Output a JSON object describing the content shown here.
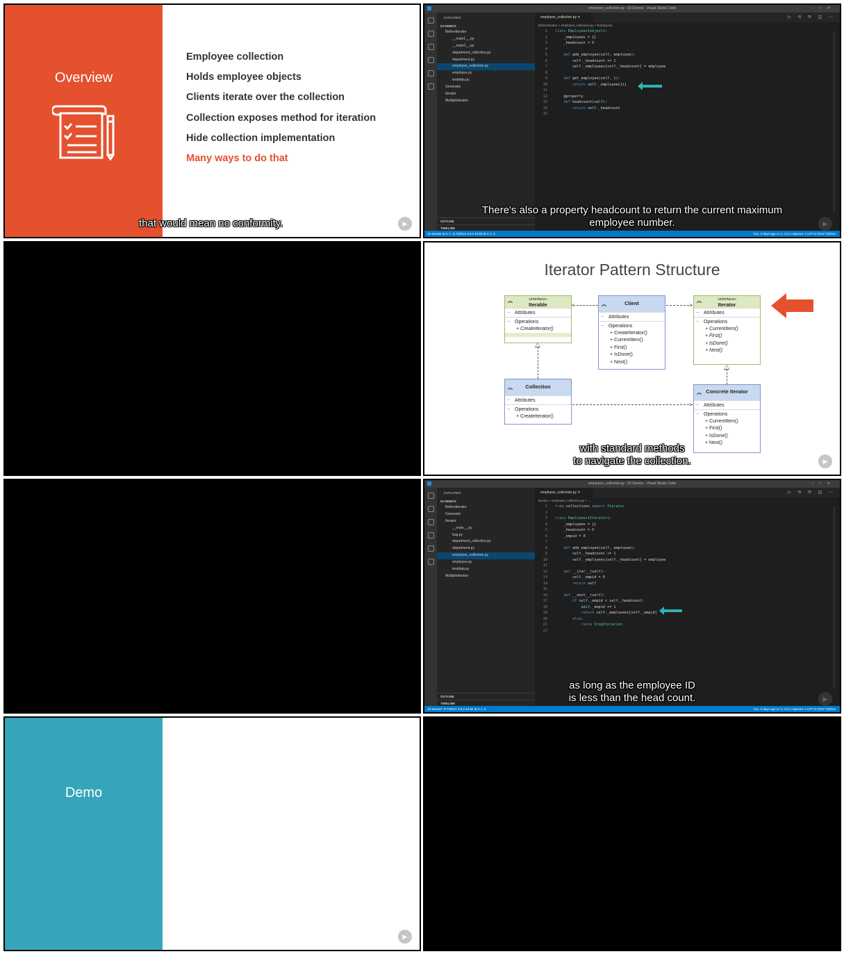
{
  "overview": {
    "title": "Overview",
    "bullets": [
      "Employee collection",
      "Holds employee objects",
      "Clients iterate over the collection",
      "Collection exposes method for iteration",
      "Hide collection implementation",
      "Many ways to do that"
    ],
    "caption": "that would mean no conformity.",
    "accent": "#e5512e"
  },
  "vscode1": {
    "title": "employee_collection.py - 03 Demos - Visual Studio Code",
    "explorer_label": "EXPLORER",
    "workspace": "03 DEMOS",
    "tree": [
      "BeforeIterator",
      "__main1__.py",
      "__main2__.py",
      "department_collection.py",
      "department.py",
      "employee_collection.py",
      "employee.py",
      "testdata.py",
      "Generator",
      "Iterator",
      "MultipleIterator"
    ],
    "tab": "employee_collection.py",
    "breadcrumb": "BeforeIterator  >  employee_collection.py  >  Employees",
    "code": [
      "class Employees(object):",
      "    _employees = {}",
      "    _headcount = 0",
      "",
      "    def add_employee(self, employee):",
      "        self._headcount += 1",
      "        self._employees[self._headcount] = employee",
      "",
      "    def get_employee(self, i):",
      "        return self._employees[i]",
      "",
      "    @property",
      "    def headcount(self):",
      "        return self._headcount",
      ""
    ],
    "outline": "OUTLINE",
    "timeline": "TIMELINE",
    "status_left": "15-Iterator   ⊗ 0 ⚠ 11   Python 3.9.2 64-bit   ⊗ 0 ⚠ 0",
    "status_right": "You, 3 days ago   Ln 1, Col 1   Spaces: 4   UTF-8   CRLF   Python",
    "caption_lines": [
      "There's also a property headcount to return the current maximum",
      "employee number."
    ]
  },
  "uml": {
    "title": "Iterator Pattern Structure",
    "attributes": "Attributes",
    "operations": "Operations",
    "stereotype": "«interface»",
    "iterable": {
      "name": "Iterable",
      "ops": [
        "+ CreateIterator()"
      ]
    },
    "client": {
      "name": "Client",
      "ops": [
        "+ CreateIterator()",
        "+ CurrentItem()",
        "+ First()",
        "+ IsDone()",
        "+ Next()"
      ]
    },
    "iterator": {
      "name": "Iterator",
      "ops": [
        "+ CurrentItem()",
        "+ First()",
        "+ IsDone()",
        "+ Next()"
      ]
    },
    "collection": {
      "name": "Collection",
      "ops": [
        "+ CreateIterator()"
      ]
    },
    "concrete": {
      "name": "Concrete Iterator",
      "ops": [
        "+ CurrentItem()",
        "+ First()",
        "+ IsDone()",
        "+ Next()"
      ]
    },
    "caption_lines": [
      "with standard methods",
      "to navigate the collection."
    ]
  },
  "vscode2": {
    "title": "employee_collection.py - 03 Demos - Visual Studio Code",
    "explorer_label": "EXPLORER",
    "workspace": "03 DEMOS",
    "tree": [
      "BeforeIterator",
      "Generator",
      "Iterator",
      "__main__.py",
      "bug.py",
      "department_collection.py",
      "department.py",
      "employee_collection.py",
      "employee.py",
      "testdata.py",
      "MultipleIterator"
    ],
    "tab": "employee_collection.py",
    "breadcrumb": "Iterator  >  employee_collection.py  >  ...",
    "code": [
      "from collections import Iterator",
      "",
      "class Employees(Iterator):",
      "    _employees = {}",
      "    _headcount = 0",
      "    _empid = 0",
      "",
      "    def add_employee(self, employee):",
      "        self._headcount += 1",
      "        self._employees[self._headcount] = employee",
      "",
      "    def __iter__(self):",
      "        self._empid = 0",
      "        return self",
      "",
      "    def __next__(self):",
      "        if self._empid < self._headcount:",
      "            self._empid += 1",
      "            return self._employees[self._empid]",
      "        else:",
      "            raise StopIteration",
      ""
    ],
    "outline": "OUTLINE",
    "timeline": "TIMELINE",
    "status_left": "15-Iterator*   ⟳   Python 3.9.2 64-bit   ⊗ 0 ⚠ 0",
    "status_right": "You, 3 days ago   Ln 1, Col 1   Spaces: 4   UTF-8   CRLF   Python",
    "caption_lines": [
      "as long as the employee ID",
      "is less than the head count."
    ]
  },
  "demo": {
    "title": "Demo",
    "accent": "#37a5b9"
  }
}
